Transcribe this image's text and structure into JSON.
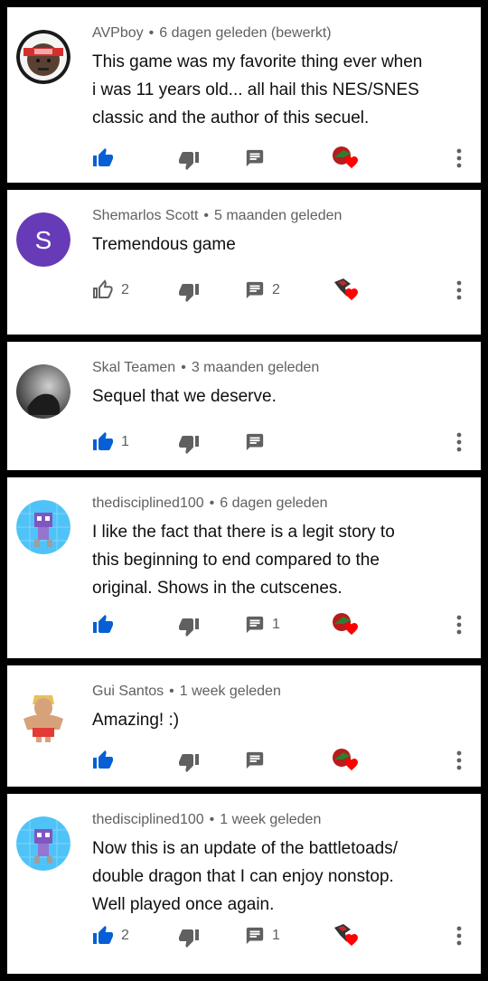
{
  "comments": [
    {
      "author": "AVPboy",
      "time": "6 dagen geleden (bewerkt)",
      "text": [
        "This game was my favorite thing ever when",
        "i was 11 years old... all hail this NES/SNES",
        "classic and the author of this secuel."
      ],
      "likes": "",
      "replies": "",
      "liked": true,
      "avatar": "gamer-headband-avatar",
      "creator_heart": "red-bird-avatar"
    },
    {
      "author": "Shemarlos Scott",
      "time": "5 maanden geleden",
      "text": [
        "Tremendous game"
      ],
      "likes": "2",
      "replies": "2",
      "liked": false,
      "avatar_letter": "S",
      "avatar_color": "#673ab7",
      "creator_heart": "feathered-avatar"
    },
    {
      "author": "Skal Teamen",
      "time": "3 maanden geleden",
      "text": [
        "Sequel that we deserve."
      ],
      "likes": "1",
      "replies": "",
      "liked": true,
      "avatar": "dark-photo-avatar",
      "creator_heart": ""
    },
    {
      "author": "thedisciplined100",
      "time": "6 dagen geleden",
      "text": [
        "I like the fact that there is a legit story to",
        "this beginning to end compared to the",
        "original.  Shows in the cutscenes."
      ],
      "likes": "",
      "replies": "1",
      "liked": true,
      "avatar": "pixel-robot-avatar",
      "creator_heart": "red-bird-avatar"
    },
    {
      "author": "Gui Santos",
      "time": "1 week geleden",
      "text": [
        "Amazing! :)"
      ],
      "likes": "",
      "replies": "",
      "liked": true,
      "avatar": "fighter-avatar",
      "creator_heart": "red-bird-avatar"
    },
    {
      "author": "thedisciplined100",
      "time": "1 week geleden",
      "text": [
        "Now this is an update of the battletoads/",
        "double dragon that I can enjoy nonstop.",
        "Well played once again."
      ],
      "likes": "2",
      "replies": "1",
      "liked": true,
      "avatar": "pixel-robot-avatar",
      "creator_heart": "feathered-avatar"
    }
  ],
  "colors": {
    "like_active": "#065fd4",
    "icon_gray": "#606060",
    "heart": "#ff0000",
    "card_bg": "#ffffff",
    "separator": "#000000"
  }
}
